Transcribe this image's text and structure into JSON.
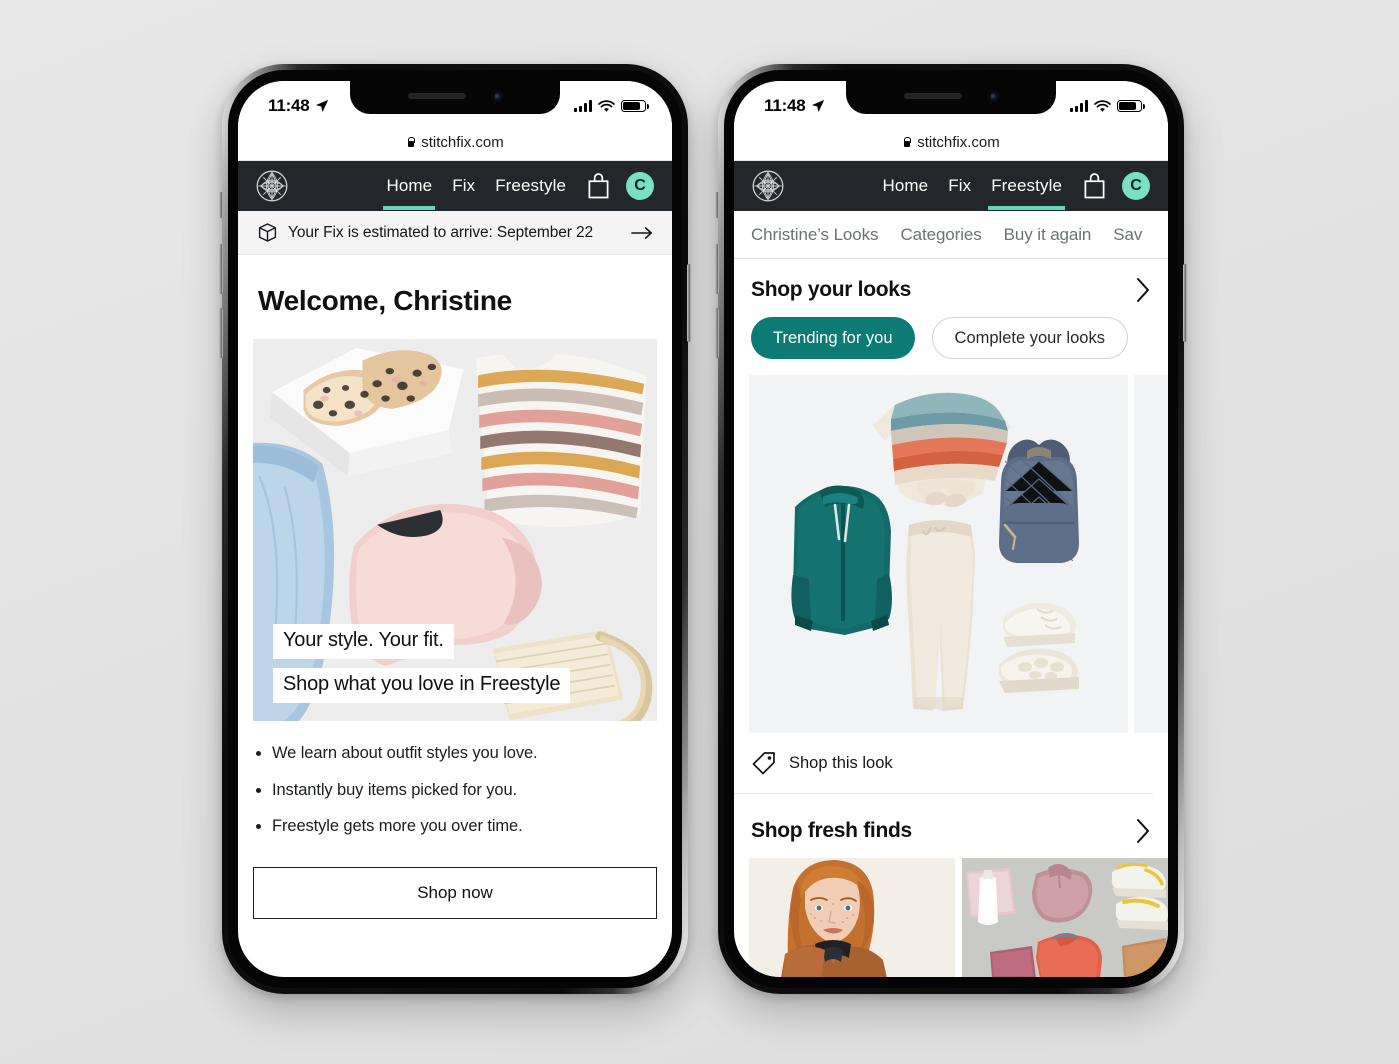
{
  "status_bar": {
    "time": "11:48",
    "location_icon": "location-arrow-icon",
    "signal_icon": "cellular-signal-icon",
    "wifi_icon": "wifi-icon",
    "battery_icon": "battery-icon"
  },
  "browser": {
    "url": "stitchfix.com",
    "lock_icon": "lock-icon"
  },
  "app_nav": {
    "logo_icon": "stitchfix-logo-icon",
    "links": [
      {
        "label": "Home"
      },
      {
        "label": "Fix"
      },
      {
        "label": "Freestyle"
      }
    ],
    "bag_icon": "shopping-bag-icon",
    "avatar_initial": "C",
    "accent_underline": "#5ed6b9",
    "avatar_bg": "#7ae0c3",
    "bar_bg": "#23272b"
  },
  "phone_home": {
    "active_tab": "Home",
    "fix_banner": {
      "icon": "package-box-icon",
      "text": "Your Fix is estimated to arrive: September 22",
      "arrow_icon": "arrow-right-icon"
    },
    "welcome_title": "Welcome, Christine",
    "hero": {
      "caption_line1": "Your style. Your fit.",
      "caption_line2": "Shop what you love in Freestyle"
    },
    "bullets": [
      "We learn about outfit styles you love.",
      "Instantly buy items picked for you.",
      "Freestyle gets more you over time."
    ],
    "cta": "Shop now"
  },
  "phone_freestyle": {
    "active_tab": "Freestyle",
    "subnav": [
      {
        "label": "Christine’s Looks"
      },
      {
        "label": "Categories"
      },
      {
        "label": "Buy it again"
      },
      {
        "label": "Sav"
      }
    ],
    "section_looks": {
      "title": "Shop your looks",
      "chevron_icon": "chevron-right-icon",
      "pills": [
        {
          "label": "Trending for you",
          "selected": true,
          "color": "#0c7b74"
        },
        {
          "label": "Complete your looks",
          "selected": false
        }
      ],
      "shop_this_look": {
        "icon": "price-tag-icon",
        "label": "Shop this look"
      }
    },
    "section_finds": {
      "title": "Shop fresh finds",
      "chevron_icon": "chevron-right-icon"
    }
  }
}
